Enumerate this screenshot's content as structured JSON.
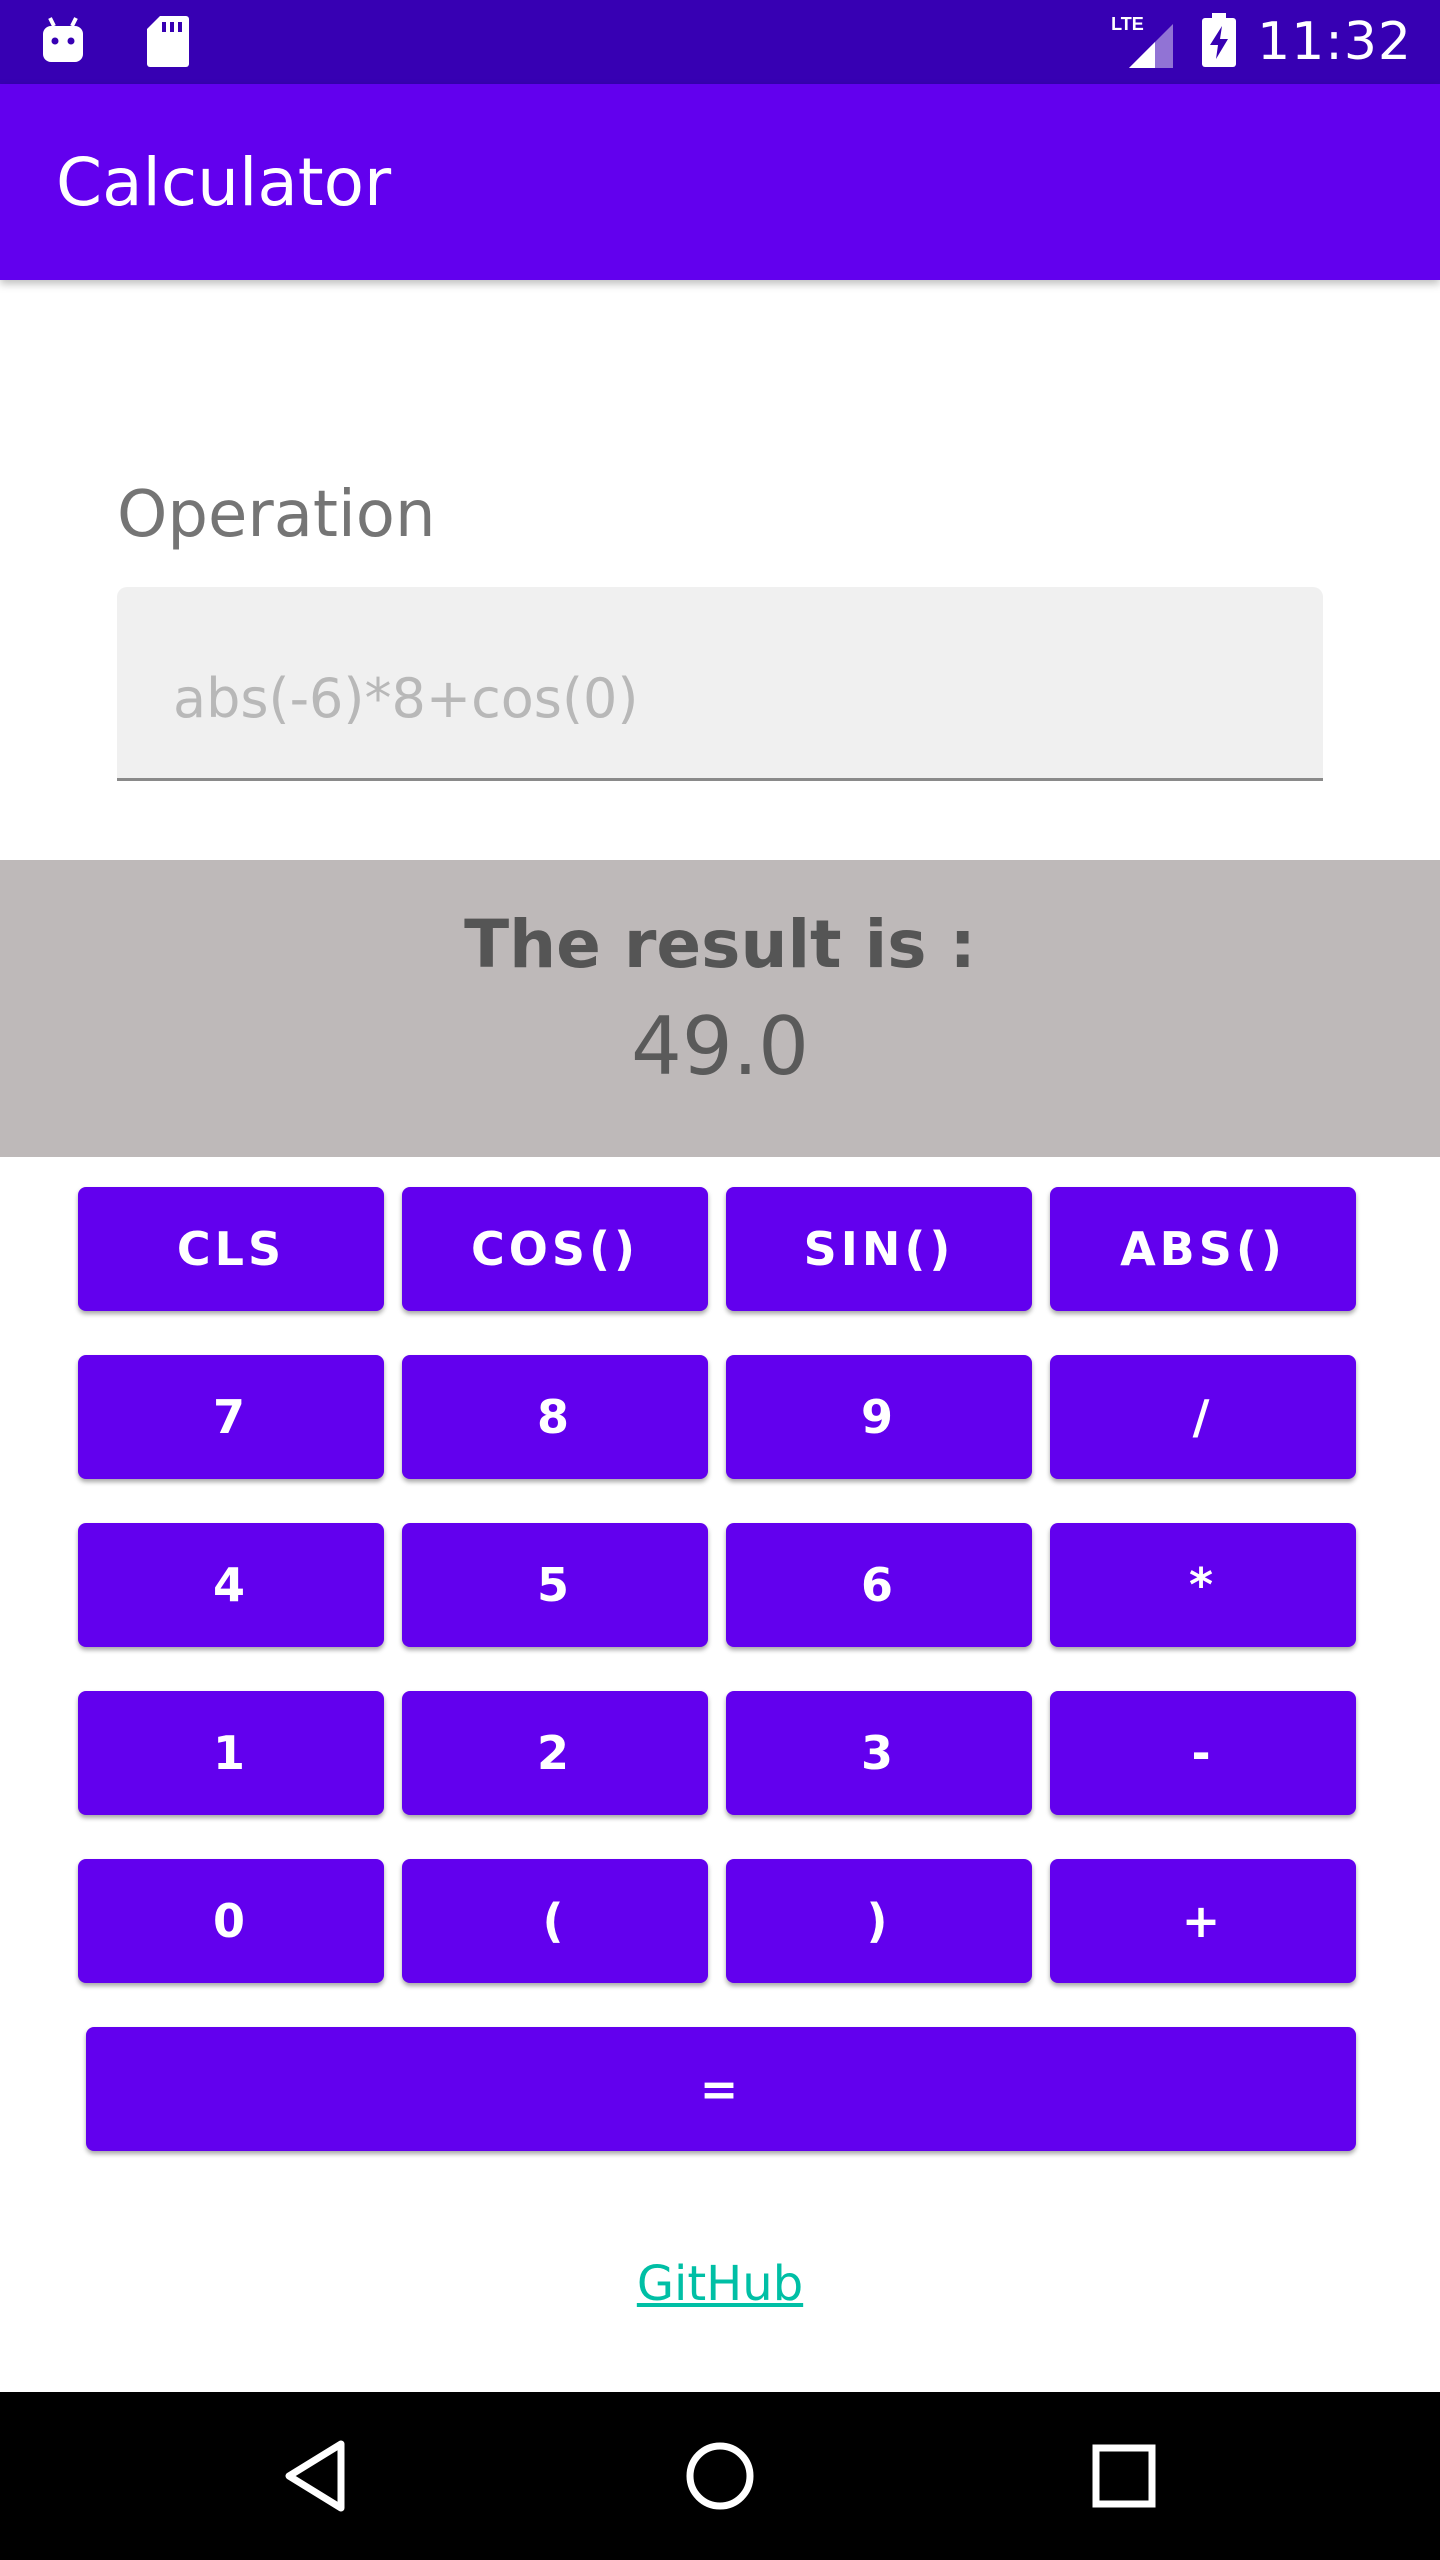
{
  "status_bar": {
    "time": "11:32",
    "network": "LTE",
    "icons": [
      "android-debug-icon",
      "sd-card-icon",
      "signal-icon",
      "battery-charging-icon"
    ]
  },
  "app_bar": {
    "title": "Calculator"
  },
  "operation": {
    "label": "Operation",
    "placeholder": "abs(-6)*8+cos(0)",
    "value": ""
  },
  "result": {
    "label": "The result is :",
    "value": "49.0"
  },
  "keypad": {
    "rows": [
      [
        "CLS",
        "COS()",
        "SIN()",
        "ABS()"
      ],
      [
        "7",
        "8",
        "9",
        "/"
      ],
      [
        "4",
        "5",
        "6",
        "*"
      ],
      [
        "1",
        "2",
        "3",
        "-"
      ],
      [
        "0",
        "(",
        ")",
        "+"
      ]
    ],
    "equals": "="
  },
  "link": {
    "github": "GitHub"
  },
  "colors": {
    "status_bar": "#3700b3",
    "primary": "#6200ee",
    "result_bg": "#beb9b9",
    "link": "#00bfa5"
  },
  "nav_bar": {
    "icons": [
      "back-icon",
      "home-icon",
      "recents-icon"
    ]
  }
}
